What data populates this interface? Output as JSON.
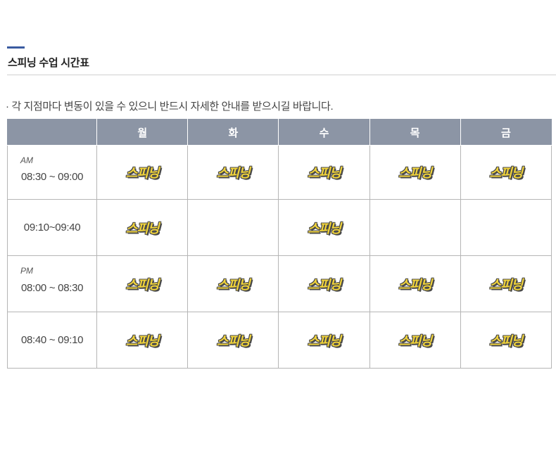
{
  "section": {
    "title": "스피닝 수업 시간표",
    "accent_color": "#3a5ba0"
  },
  "notice": "· 각 지점마다 변동이 있을 수 있으니 반드시 자세한 안내를 받으시길 바랍니다.",
  "table": {
    "header_bg": "#8c95a5",
    "days": [
      "월",
      "화",
      "수",
      "목",
      "금"
    ],
    "rows": [
      {
        "period": "AM",
        "time": "08:30 ~ 09:00",
        "classes": [
          "스피닝",
          "스피닝",
          "스피닝",
          "스피닝",
          "스피닝"
        ]
      },
      {
        "period": "",
        "time": "09:10~09:40",
        "classes": [
          "스피닝",
          "",
          "스피닝",
          "",
          ""
        ]
      },
      {
        "period": "PM",
        "time": "08:00 ~ 08:30",
        "classes": [
          "스피닝",
          "스피닝",
          "스피닝",
          "스피닝",
          "스피닝"
        ]
      },
      {
        "period": "",
        "time": "08:40 ~ 09:10",
        "classes": [
          "스피닝",
          "스피닝",
          "스피닝",
          "스피닝",
          "스피닝"
        ]
      }
    ]
  }
}
